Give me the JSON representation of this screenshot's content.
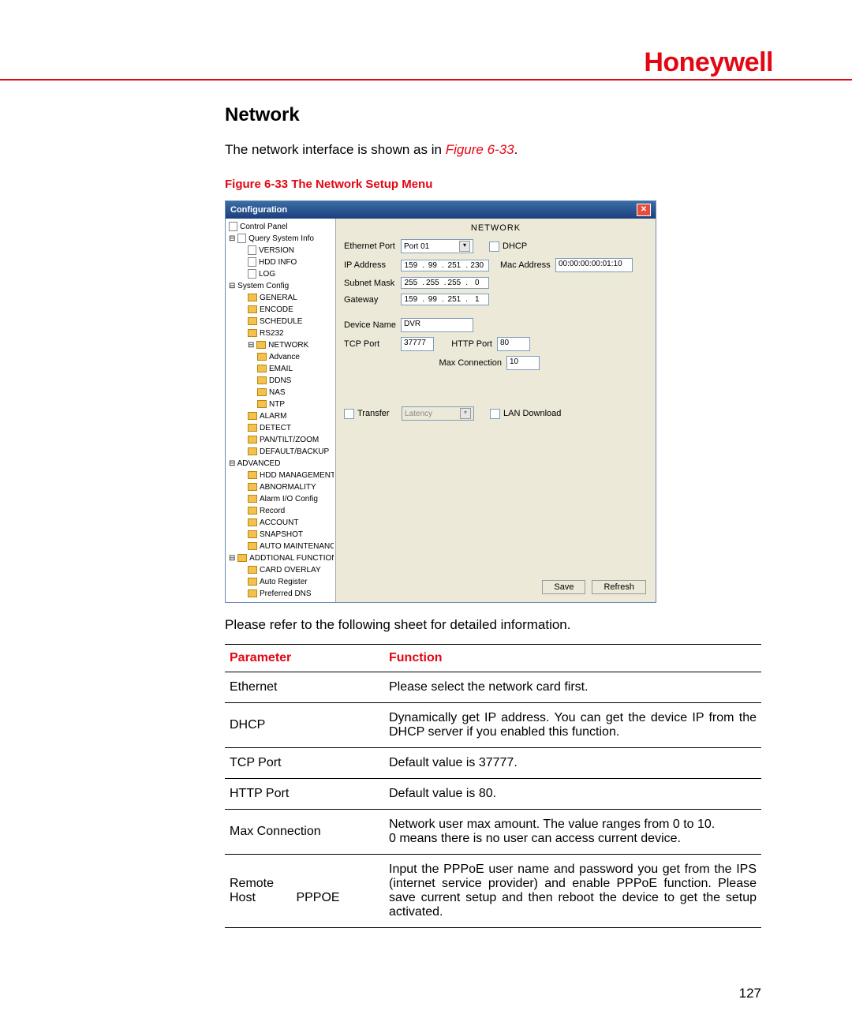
{
  "brand": "Honeywell",
  "section_heading": "Network",
  "intro_prefix": "The network interface is shown as in ",
  "intro_figref": "Figure 6-33",
  "intro_suffix": ".",
  "figure_caption": "Figure 6-33 The Network Setup Menu",
  "win": {
    "title": "Configuration",
    "panel_title": "NETWORK",
    "tree": {
      "control_panel": "Control Panel",
      "query": "Query System Info",
      "version": "VERSION",
      "hdd_info": "HDD INFO",
      "log": "LOG",
      "system_config": "System Config",
      "general": "GENERAL",
      "encode": "ENCODE",
      "schedule": "SCHEDULE",
      "rs232": "RS232",
      "network": "NETWORK",
      "advance": "Advance",
      "email": "EMAIL",
      "ddns": "DDNS",
      "nas": "NAS",
      "ntp": "NTP",
      "alarm": "ALARM",
      "detect": "DETECT",
      "ptz": "PAN/TILT/ZOOM",
      "default_backup": "DEFAULT/BACKUP",
      "advanced": "ADVANCED",
      "hdd_mgmt": "HDD MANAGEMENT",
      "abnormality": "ABNORMALITY",
      "alarm_io": "Alarm I/O Config",
      "record": "Record",
      "account": "ACCOUNT",
      "snapshot": "SNAPSHOT",
      "auto_maint": "AUTO MAINTENANCE",
      "add_func": "ADDTIONAL FUNCTION",
      "card_overlay": "CARD OVERLAY",
      "auto_register": "Auto Register",
      "pref_dns": "Preferred DNS"
    },
    "fields": {
      "ethernet_port": {
        "label": "Ethernet Port",
        "value": "Port 01"
      },
      "dhcp": {
        "label": "DHCP"
      },
      "ip_address": {
        "label": "IP Address",
        "o1": "159",
        "o2": "99",
        "o3": "251",
        "o4": "230"
      },
      "mac_address": {
        "label": "Mac Address",
        "value": "00:00:00:00:01:10"
      },
      "subnet": {
        "label": "Subnet Mask",
        "o1": "255",
        "o2": "255",
        "o3": "255",
        "o4": "0"
      },
      "gateway": {
        "label": "Gateway",
        "o1": "159",
        "o2": "99",
        "o3": "251",
        "o4": "1"
      },
      "device_name": {
        "label": "Device Name",
        "value": "DVR"
      },
      "tcp_port": {
        "label": "TCP Port",
        "value": "37777"
      },
      "http_port": {
        "label": "HTTP Port",
        "value": "80"
      },
      "max_conn": {
        "label": "Max Connection",
        "value": "10"
      },
      "transfer": {
        "label": "Transfer",
        "value": "Latency"
      },
      "lan_download": {
        "label": "LAN Download"
      }
    },
    "buttons": {
      "save": "Save",
      "refresh": "Refresh"
    }
  },
  "after_figure": "Please refer to the following sheet for detailed information.",
  "table": {
    "header_param": "Parameter",
    "header_func": "Function",
    "rows": [
      {
        "param": "Ethernet",
        "func": "Please select the network card first."
      },
      {
        "param": "DHCP",
        "func": "Dynamically get IP address. You can get the device IP from the DHCP server if you enabled this function."
      },
      {
        "param": "TCP Port",
        "func": "Default value is 37777."
      },
      {
        "param": "HTTP  Port",
        "func": "Default value is 80."
      },
      {
        "param": "Max Connection",
        "func": "Network user max amount. The value ranges from 0 to 10.\n0 means there is no user can access current device."
      },
      {
        "param": "Remote Host",
        "param2": "PPPOE",
        "func": "Input the PPPoE user name and password you get from the IPS (internet service provider) and enable PPPoE function. Please save current setup and then reboot the device to get the setup activated."
      }
    ]
  },
  "page_number": "127"
}
